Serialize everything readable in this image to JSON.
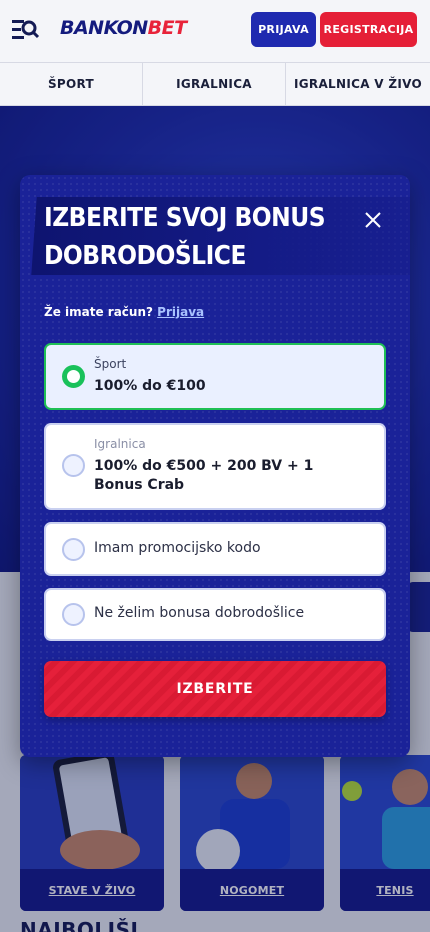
{
  "header": {
    "logo_part1": "BANKON",
    "logo_part2": "BET",
    "login_label": "PRIJAVA",
    "register_label": "REGISTRACIJA",
    "menu_icon": "search-menu-icon"
  },
  "nav": {
    "items": [
      {
        "label": "ŠPORT"
      },
      {
        "label": "IGRALNICA"
      },
      {
        "label": "IGRALNICA V ŽIVO"
      }
    ]
  },
  "cards": [
    {
      "label": "STAVE V ŽIVO"
    },
    {
      "label": "NOGOMET"
    },
    {
      "label": "TENIS"
    }
  ],
  "section_heading": "NAJBOLJŠI",
  "modal": {
    "title": "IZBERITE SVOJ BONUS DOBRODOŠLICE",
    "account_text": "Že imate račun?",
    "account_link": "Prijava",
    "options": [
      {
        "category": "Šport",
        "text": "100% do €100",
        "selected": true
      },
      {
        "category": "Igralnica",
        "text": "100% do €500 + 200 BV + 1 Bonus Crab",
        "selected": false
      },
      {
        "text": "Imam promocijsko kodo",
        "selected": false
      },
      {
        "text": "Ne želim bonusa dobrodošlice",
        "selected": false
      }
    ],
    "submit_label": "IZBERITE"
  },
  "colors": {
    "brand_blue": "#1f2ab0",
    "brand_red": "#e51f37",
    "modal_bg": "#1a2298",
    "selected_green": "#1fbf55"
  }
}
